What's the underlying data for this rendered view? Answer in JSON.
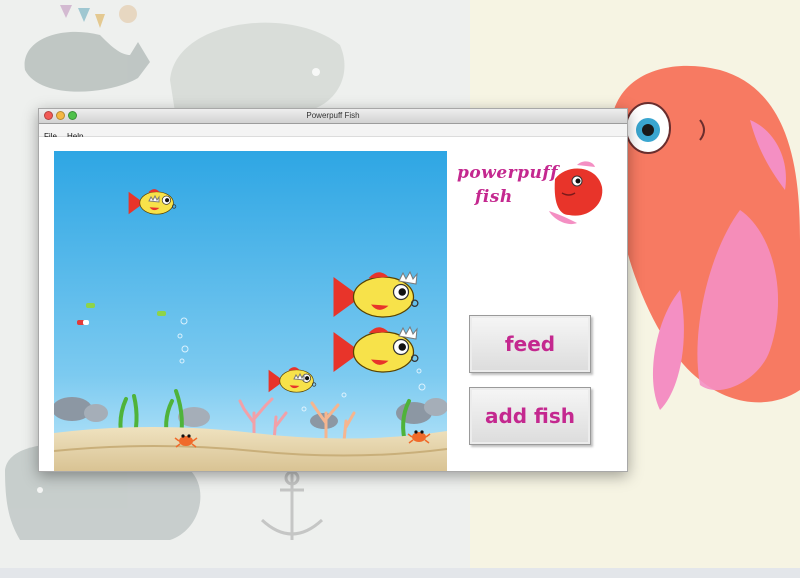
{
  "window": {
    "title": "Powerpuff Fish"
  },
  "menu": {
    "items": [
      "File",
      "Help"
    ]
  },
  "logo": {
    "line1": "powerpuff",
    "line2": "fish"
  },
  "buttons": {
    "feed_label": "feed",
    "add_fish_label": "add fish"
  },
  "icons": {
    "close": "close-icon",
    "minimize": "minimize-icon",
    "maximize": "maximize-icon",
    "fish": "fish-icon",
    "crab": "crab-icon",
    "food": "food-pellet-icon"
  },
  "colors": {
    "accent": "#c4288f",
    "water_top": "#2ea6e4",
    "water_bottom": "#bfe8fa",
    "sand": "#e8d8b0",
    "fish_body": "#f7e24a",
    "fish_fin": "#e8342a"
  }
}
